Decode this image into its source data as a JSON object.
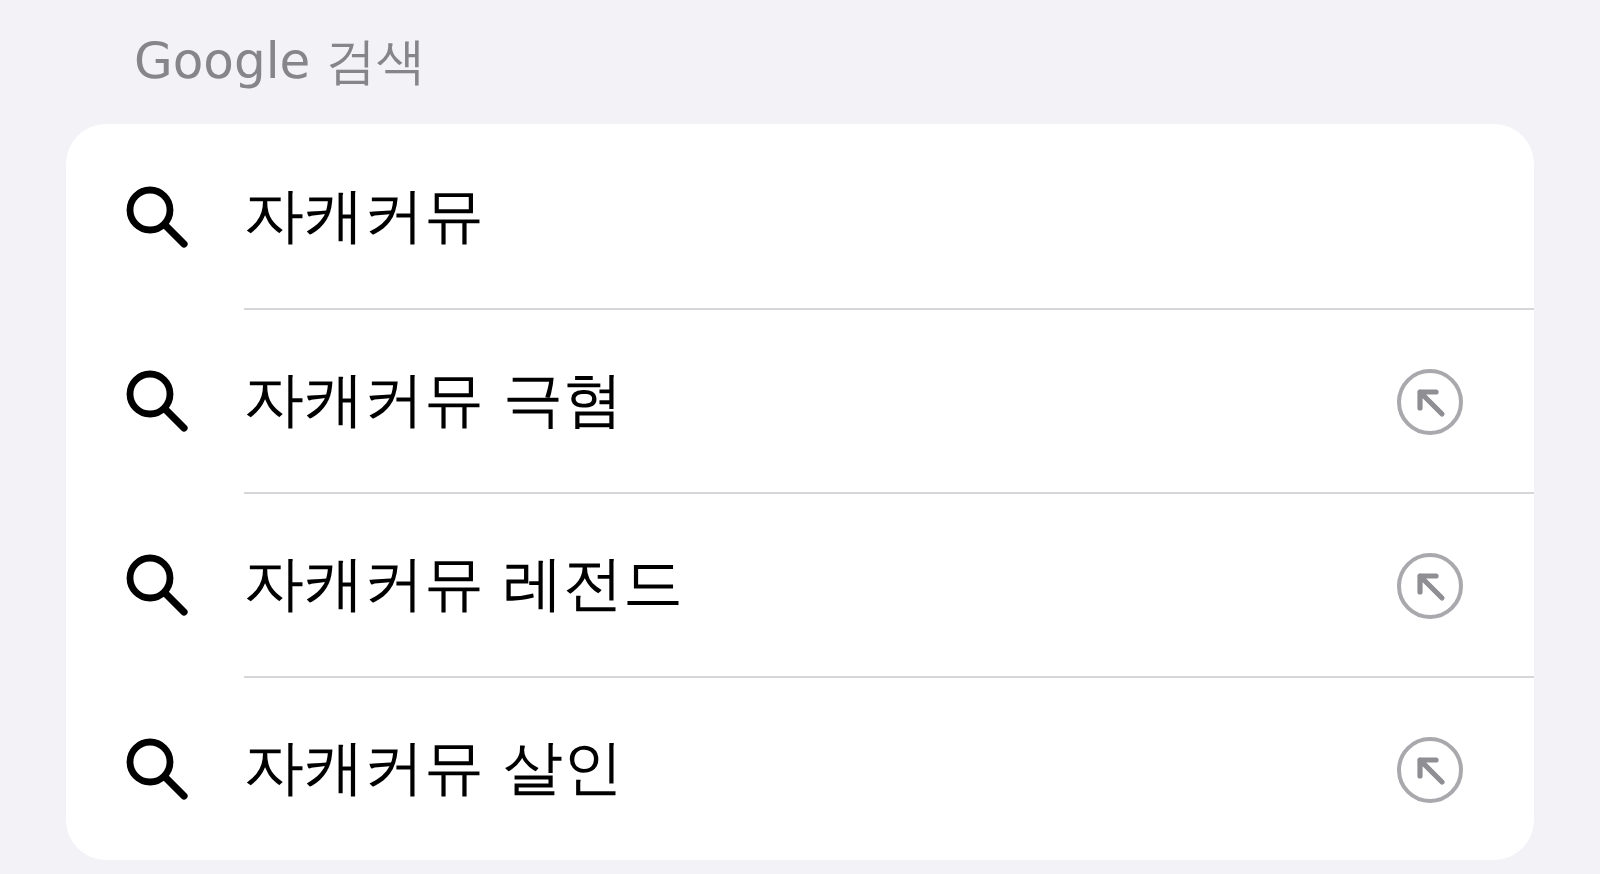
{
  "section_title": "Google 검색",
  "suggestions": [
    {
      "kind": "typed",
      "text": "자캐커뮤"
    },
    {
      "kind": "suggestion",
      "text": "자캐커뮤 극혐"
    },
    {
      "kind": "suggestion",
      "text": "자캐커뮤 레전드"
    },
    {
      "kind": "suggestion",
      "text": "자캐커뮤 살인"
    }
  ]
}
